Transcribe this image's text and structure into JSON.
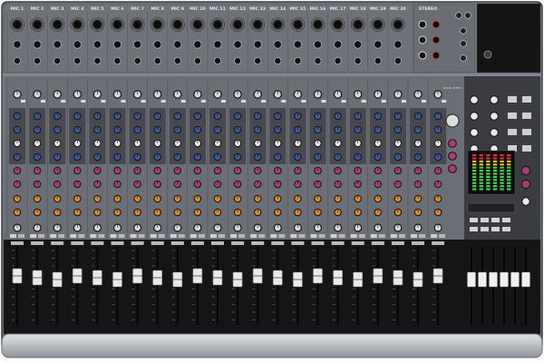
{
  "device": {
    "mic_channels": [
      "MIC 1",
      "MIC 2",
      "MIC 3",
      "MIC 4",
      "MIC 5",
      "MIC 6",
      "MIC 7",
      "MIC 8",
      "MIC 9",
      "MIC 10",
      "MIC 11",
      "MIC 12",
      "MIC 13",
      "MIC 14",
      "MIC 15",
      "MIC 16",
      "MIC 17",
      "MIC 18",
      "MIC 19",
      "MIC 20"
    ],
    "stereo_label": "STEREO",
    "effects_label": "DIGITAL EFFECT",
    "colors": {
      "panel": "#7b7e85",
      "panel_dark": "#4a4c51",
      "strip_dark": "#2b2c30",
      "fader_bay": "#151517",
      "blue_knob": "#3c5a9a",
      "pink_knob": "#b03c6e",
      "orange_knob": "#e08a2a",
      "white_knob": "#e9e9e9",
      "rail": "#c8cace"
    },
    "meter_segments": 12
  }
}
